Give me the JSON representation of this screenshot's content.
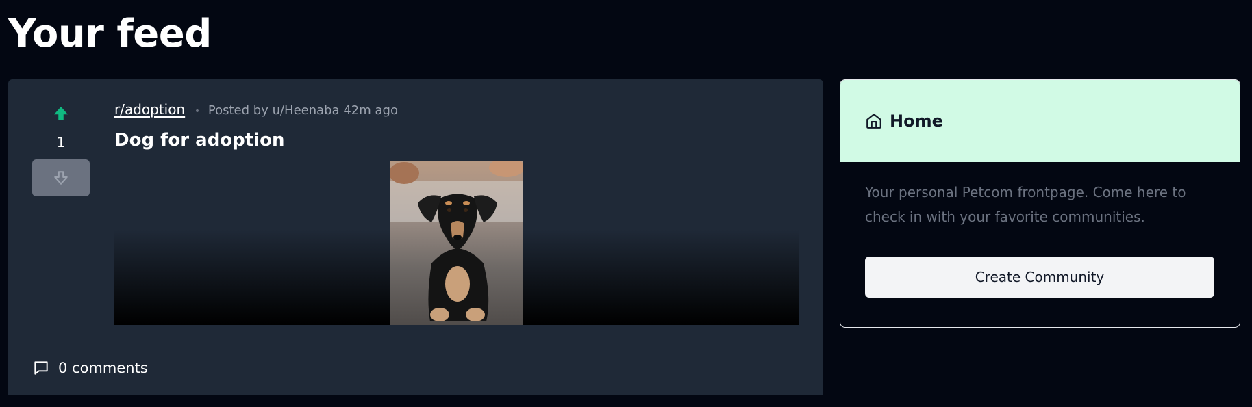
{
  "page": {
    "title": "Your feed"
  },
  "post": {
    "subreddit": "r/adoption",
    "meta_dot": "•",
    "meta": "Posted by u/Heenaba 42m ago",
    "title": "Dog for adoption",
    "votes": "1",
    "comments": "0 comments",
    "image_alt": "dog-photo",
    "colors": {
      "upvote_active": "#10b981",
      "card_bg": "#1f2937",
      "downvote_bg": "#6b7280"
    }
  },
  "sidebar": {
    "title": "Home",
    "description": "Your personal Petcom frontpage. Come here to check in with your favorite communities.",
    "create_button": "Create Community",
    "colors": {
      "header_bg": "#d1fae5",
      "page_bg": "#030712"
    }
  },
  "icons": {
    "upvote": "arrow-big-up-icon",
    "downvote": "arrow-big-down-icon",
    "comment": "message-square-icon",
    "home": "home-icon"
  }
}
